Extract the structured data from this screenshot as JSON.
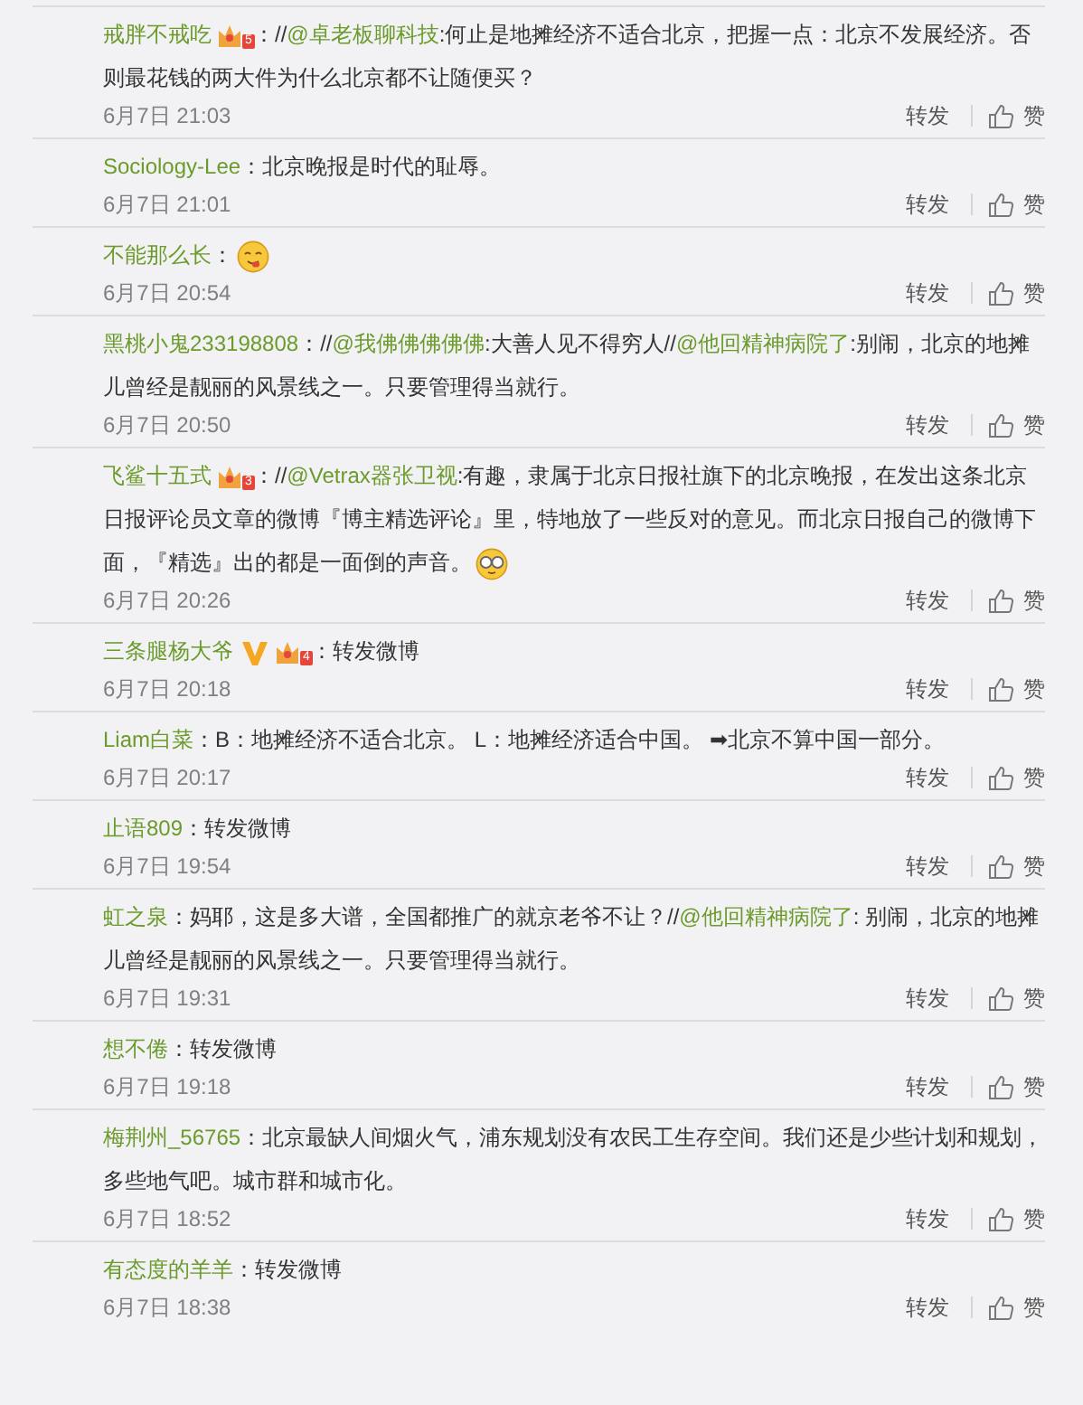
{
  "comments": [
    {
      "user": "戒胖不戒吃",
      "badges": [
        {
          "kind": "member",
          "rank": "5"
        }
      ],
      "body": [
        {
          "kind": "text",
          "text": "：//"
        },
        {
          "kind": "mention",
          "text": "@卓老板聊科技"
        },
        {
          "kind": "text",
          "text": ":何止是地摊经济不适合北京，把握一点：北京不发展经济。否则最花钱的两大件为什么北京都不让随便买？"
        }
      ],
      "time": "6月7日 21:03",
      "repost": "转发",
      "like": "赞"
    },
    {
      "user": "Sociology-Lee",
      "body": [
        {
          "kind": "text",
          "text": "：北京晚报是时代的耻辱。"
        }
      ],
      "time": "6月7日 21:01",
      "repost": "转发",
      "like": "赞"
    },
    {
      "user": "不能那么长",
      "body": [
        {
          "kind": "text",
          "text": "："
        },
        {
          "kind": "yum_emoji"
        }
      ],
      "time": "6月7日 20:54",
      "repost": "转发",
      "like": "赞"
    },
    {
      "user": "黑桃小鬼233198808",
      "body": [
        {
          "kind": "text",
          "text": "：//"
        },
        {
          "kind": "mention",
          "text": "@我佛佛佛佛佛"
        },
        {
          "kind": "text",
          "text": ":大善人见不得穷人//"
        },
        {
          "kind": "mention",
          "text": "@他回精神病院了"
        },
        {
          "kind": "text",
          "text": ":别闹，北京的地摊儿曾经是靓丽的风景线之一。只要管理得当就行。"
        }
      ],
      "time": "6月7日 20:50",
      "repost": "转发",
      "like": "赞"
    },
    {
      "user": "飞鲨十五式",
      "badges": [
        {
          "kind": "member",
          "rank": "3"
        }
      ],
      "body": [
        {
          "kind": "text",
          "text": "：//"
        },
        {
          "kind": "mention",
          "text": "@Vetrax器张卫视"
        },
        {
          "kind": "text",
          "text": ":有趣，隶属于北京日报社旗下的北京晚报，在发出这条北京日报评论员文章的微博『博主精选评论』里，特地放了一些反对的意见。而北京日报自己的微博下面，『精选』出的都是一面倒的声音。"
        },
        {
          "kind": "glasses_emoji"
        }
      ],
      "time": "6月7日 20:26",
      "repost": "转发",
      "like": "赞"
    },
    {
      "user": "三条腿杨大爷",
      "badges": [
        {
          "kind": "verified"
        },
        {
          "kind": "member",
          "rank": "4"
        }
      ],
      "body": [
        {
          "kind": "text",
          "text": "：转发微博"
        }
      ],
      "time": "6月7日 20:18",
      "repost": "转发",
      "like": "赞"
    },
    {
      "user": "Liam白菜",
      "body": [
        {
          "kind": "text",
          "text": "：B：地摊经济不适合北京。 L：地摊经济适合中国。 ➡北京不算中国一部分。"
        }
      ],
      "time": "6月7日 20:17",
      "repost": "转发",
      "like": "赞"
    },
    {
      "user": "止语809",
      "body": [
        {
          "kind": "text",
          "text": "：转发微博"
        }
      ],
      "time": "6月7日 19:54",
      "repost": "转发",
      "like": "赞"
    },
    {
      "user": "虹之泉",
      "body": [
        {
          "kind": "text",
          "text": "：妈耶，这是多大谱，全国都推广的就京老爷不让？//"
        },
        {
          "kind": "mention",
          "text": "@他回精神病院了"
        },
        {
          "kind": "text",
          "text": ": 别闹，北京的地摊儿曾经是靓丽的风景线之一。只要管理得当就行。"
        }
      ],
      "time": "6月7日 19:31",
      "repost": "转发",
      "like": "赞"
    },
    {
      "user": "想不倦",
      "body": [
        {
          "kind": "text",
          "text": "：转发微博"
        }
      ],
      "time": "6月7日 19:18",
      "repost": "转发",
      "like": "赞"
    },
    {
      "user": "梅荆州_56765",
      "body": [
        {
          "kind": "text",
          "text": "：北京最缺人间烟火气，浦东规划没有农民工生存空间。我们还是少些计划和规划，多些地气吧。城市群和城市化。"
        }
      ],
      "time": "6月7日 18:52",
      "repost": "转发",
      "like": "赞"
    },
    {
      "user": "有态度的羊羊",
      "body": [
        {
          "kind": "text",
          "text": "：转发微博"
        }
      ],
      "time": "6月7日 18:38",
      "repost": "转发",
      "like": "赞"
    }
  ]
}
